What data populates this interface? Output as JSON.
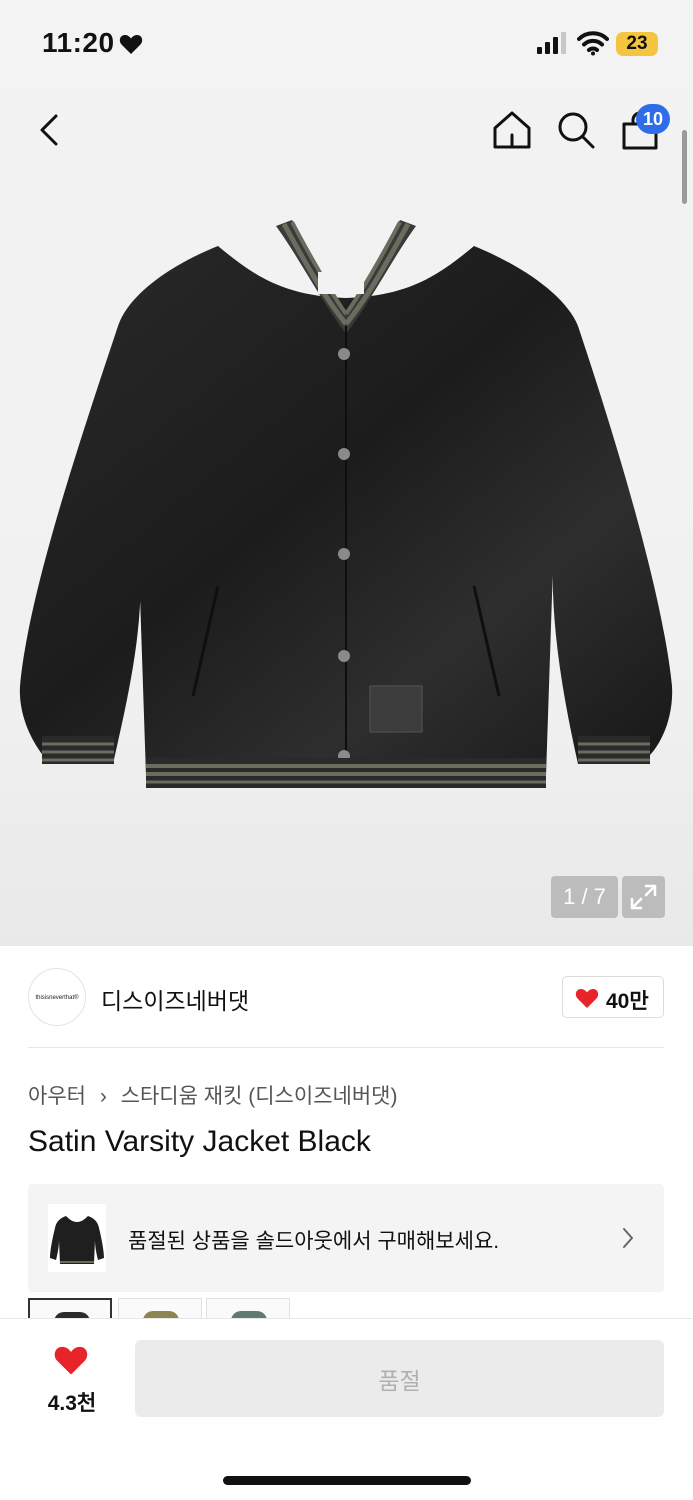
{
  "status_bar": {
    "time": "11:20",
    "battery": "23",
    "icons": [
      "heart-icon",
      "signal-icon",
      "wifi-icon",
      "battery-icon"
    ]
  },
  "header": {
    "icons": [
      "back-icon",
      "home-icon",
      "search-icon",
      "cart-icon"
    ],
    "cart_count": "10"
  },
  "gallery": {
    "counter": "1 / 7",
    "expand_icon": "expand-icon"
  },
  "brand": {
    "logo_text": "thisisneverthat®",
    "name": "디스이즈네버댓",
    "like_count": "40만"
  },
  "breadcrumb": {
    "items": [
      "아우터",
      "스타디움 재킷 (디스이즈네버댓)"
    ],
    "separator": "›"
  },
  "product": {
    "title": "Satin Varsity Jacket Black"
  },
  "soldout_banner": {
    "text": "품절된 상품을 솔드아웃에서 구매해보세요."
  },
  "colors": {
    "accent": "#2f6de8",
    "like_red": "#e8232a",
    "battery_yellow": "#f5c542",
    "swatches": [
      "#2b2b2b",
      "#8b8552",
      "#5f7a70"
    ]
  },
  "bottom_bar": {
    "like_count": "4.3천",
    "soldout_label": "품절"
  }
}
